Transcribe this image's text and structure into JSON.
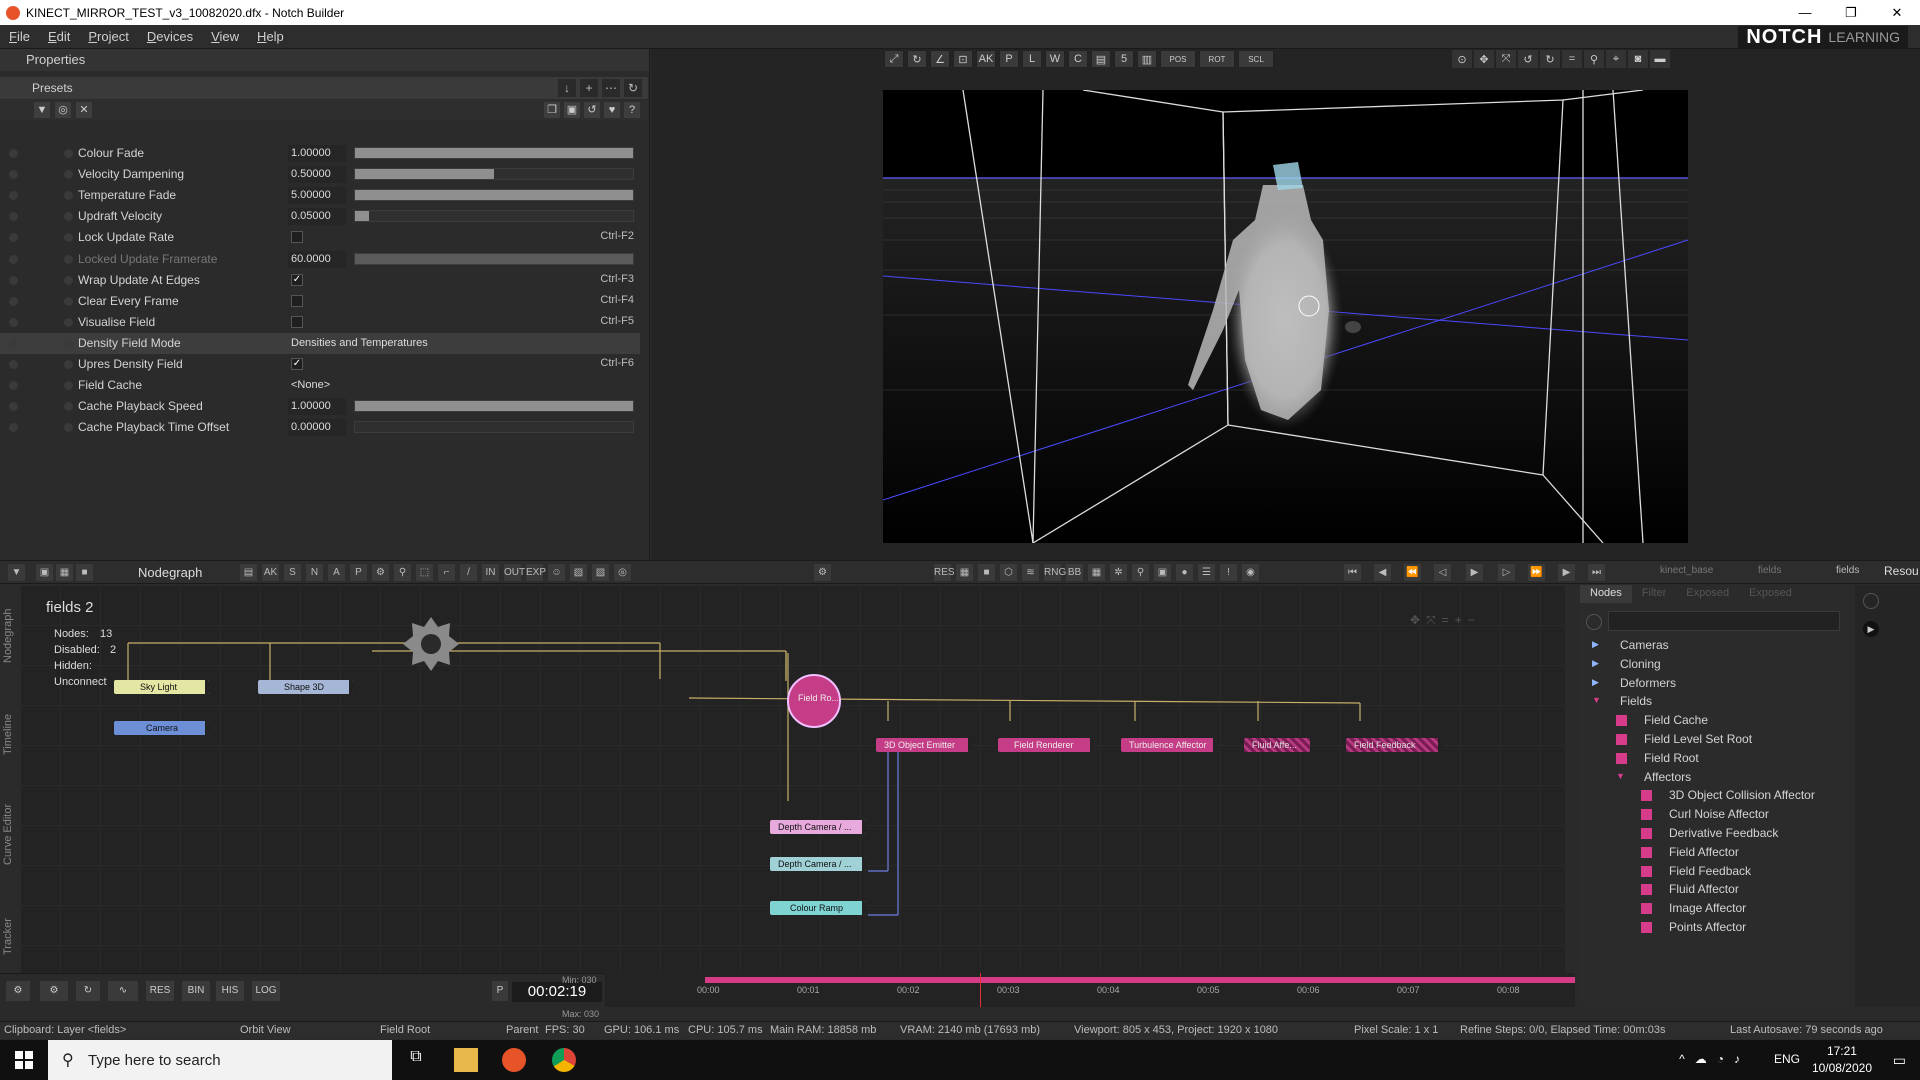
{
  "window": {
    "title": "KINECT_MIRROR_TEST_v3_10082020.dfx - Notch Builder",
    "minimize": "—",
    "maximize": "❐",
    "close": "✕"
  },
  "menu": [
    "File",
    "Edit",
    "Project",
    "Devices",
    "View",
    "Help"
  ],
  "logo": {
    "brand": "NOTCH",
    "sub": "LEARNING"
  },
  "properties": {
    "title": "Properties",
    "presets_label": "Presets",
    "rows": [
      {
        "label": "Colour Fade",
        "value": "1.00000",
        "fill": 1.0
      },
      {
        "label": "Velocity Dampening",
        "value": "0.50000",
        "fill": 0.5
      },
      {
        "label": "Temperature Fade",
        "value": "5.00000",
        "fill": 1.0
      },
      {
        "label": "Updraft Velocity",
        "value": "0.05000",
        "fill": 0.05
      },
      {
        "label": "Lock Update Rate",
        "shortcut": "Ctrl-F2"
      },
      {
        "label": "Locked Update Framerate",
        "value": "60.0000",
        "fill": 1.0
      },
      {
        "label": "Wrap Update At Edges",
        "check": "✓",
        "shortcut": "Ctrl-F3"
      },
      {
        "label": "Clear Every Frame",
        "shortcut": "Ctrl-F4"
      },
      {
        "label": "Visualise Field",
        "shortcut": "Ctrl-F5"
      },
      {
        "label": "Density Field Mode",
        "dropdown": "Densities and Temperatures"
      },
      {
        "label": "Upres Density Field",
        "check": "✓",
        "shortcut": "Ctrl-F6"
      },
      {
        "label": "Field Cache",
        "dropdown": "<None>"
      },
      {
        "label": "Cache Playback Speed",
        "value": "1.00000",
        "fill": 1.0
      },
      {
        "label": "Cache Playback Time Offset",
        "value": "0.00000",
        "fill": 0.0
      }
    ]
  },
  "viewport": {
    "toolbar_number": "5",
    "pos_label": "POS",
    "rot_label": "ROT",
    "scl_label": "SCL"
  },
  "nodegraph": {
    "title": "Nodegraph",
    "layer_name": "fields 2",
    "stats": {
      "nodes": "Nodes:",
      "nodes_count": "13",
      "disabled": "Disabled:",
      "disabled_count": "2",
      "hidden": "Hidden:",
      "unconnected": "Unconnect"
    },
    "nodes": {
      "sky_light": "Sky Light",
      "shape_3d": "Shape 3D",
      "camera": "Camera",
      "field_root": "Field Ro...",
      "object_emitter": "3D Object Emitter",
      "field_renderer": "Field Renderer",
      "turbulence": "Turbulence Affector",
      "disabled1": "Fluid Affe...",
      "disabled2": "Field Feedback",
      "depth_camera_1": "Depth Camera / ...",
      "depth_camera_2": "Depth Camera / ...",
      "colour_ramp": "Colour Ramp"
    },
    "breadcrumbs": [
      "kinect_base",
      "fields",
      "fields"
    ],
    "resources_label": "Resou"
  },
  "nodes_panel": {
    "tabs": [
      "Nodes",
      "Filter",
      "Exposed",
      "Exposed"
    ],
    "tree": [
      {
        "label": "Cameras",
        "type": "folder"
      },
      {
        "label": "Cloning",
        "type": "folder"
      },
      {
        "label": "Deformers",
        "type": "folder"
      },
      {
        "label": "Fields",
        "type": "folder-open"
      },
      {
        "label": "Field Cache",
        "type": "node"
      },
      {
        "label": "Field Level Set Root",
        "type": "node"
      },
      {
        "label": "Field Root",
        "type": "node"
      },
      {
        "label": "Affectors",
        "type": "folder-open-sub"
      },
      {
        "label": "3D Object Collision Affector",
        "type": "node-sub"
      },
      {
        "label": "Curl Noise Affector",
        "type": "node-sub"
      },
      {
        "label": "Derivative Feedback",
        "type": "node-sub"
      },
      {
        "label": "Field Affector",
        "type": "node-sub"
      },
      {
        "label": "Field Feedback",
        "type": "node-sub"
      },
      {
        "label": "Fluid Affector",
        "type": "node-sub"
      },
      {
        "label": "Image Affector",
        "type": "node-sub"
      },
      {
        "label": "Points Affector",
        "type": "node-sub"
      }
    ]
  },
  "transport": {
    "buttons": [
      "RES",
      "BIN",
      "HIS",
      "LOG"
    ],
    "p_label": "P",
    "timecode": "00:02:19",
    "min": "Min: 030",
    "max": "Max: 030",
    "ticks": [
      "00:00",
      "00:01",
      "00:02",
      "00:03",
      "00:04",
      "00:05",
      "00:06",
      "00:07",
      "00:08"
    ]
  },
  "status": {
    "clipboard": "Clipboard: Layer <fields>",
    "view": "Orbit View",
    "node": "Field Root",
    "parent": "Parent",
    "fps": "FPS: 30",
    "gpu": "GPU: 106.1 ms",
    "cpu": "CPU: 105.7 ms",
    "ram": "Main RAM: 18858 mb",
    "vram": "VRAM: 2140 mb (17693 mb)",
    "viewport": "Viewport: 805 x 453, Project: 1920 x 1080",
    "pixel_scale": "Pixel Scale: 1 x 1",
    "refine": "Refine Steps: 0/0, Elapsed Time: 00m:03s",
    "autosave": "Last Autosave: 79 seconds ago"
  },
  "taskbar": {
    "search_placeholder": "Type here to search",
    "lang": "ENG",
    "time": "17:21",
    "date": "10/08/2020"
  }
}
